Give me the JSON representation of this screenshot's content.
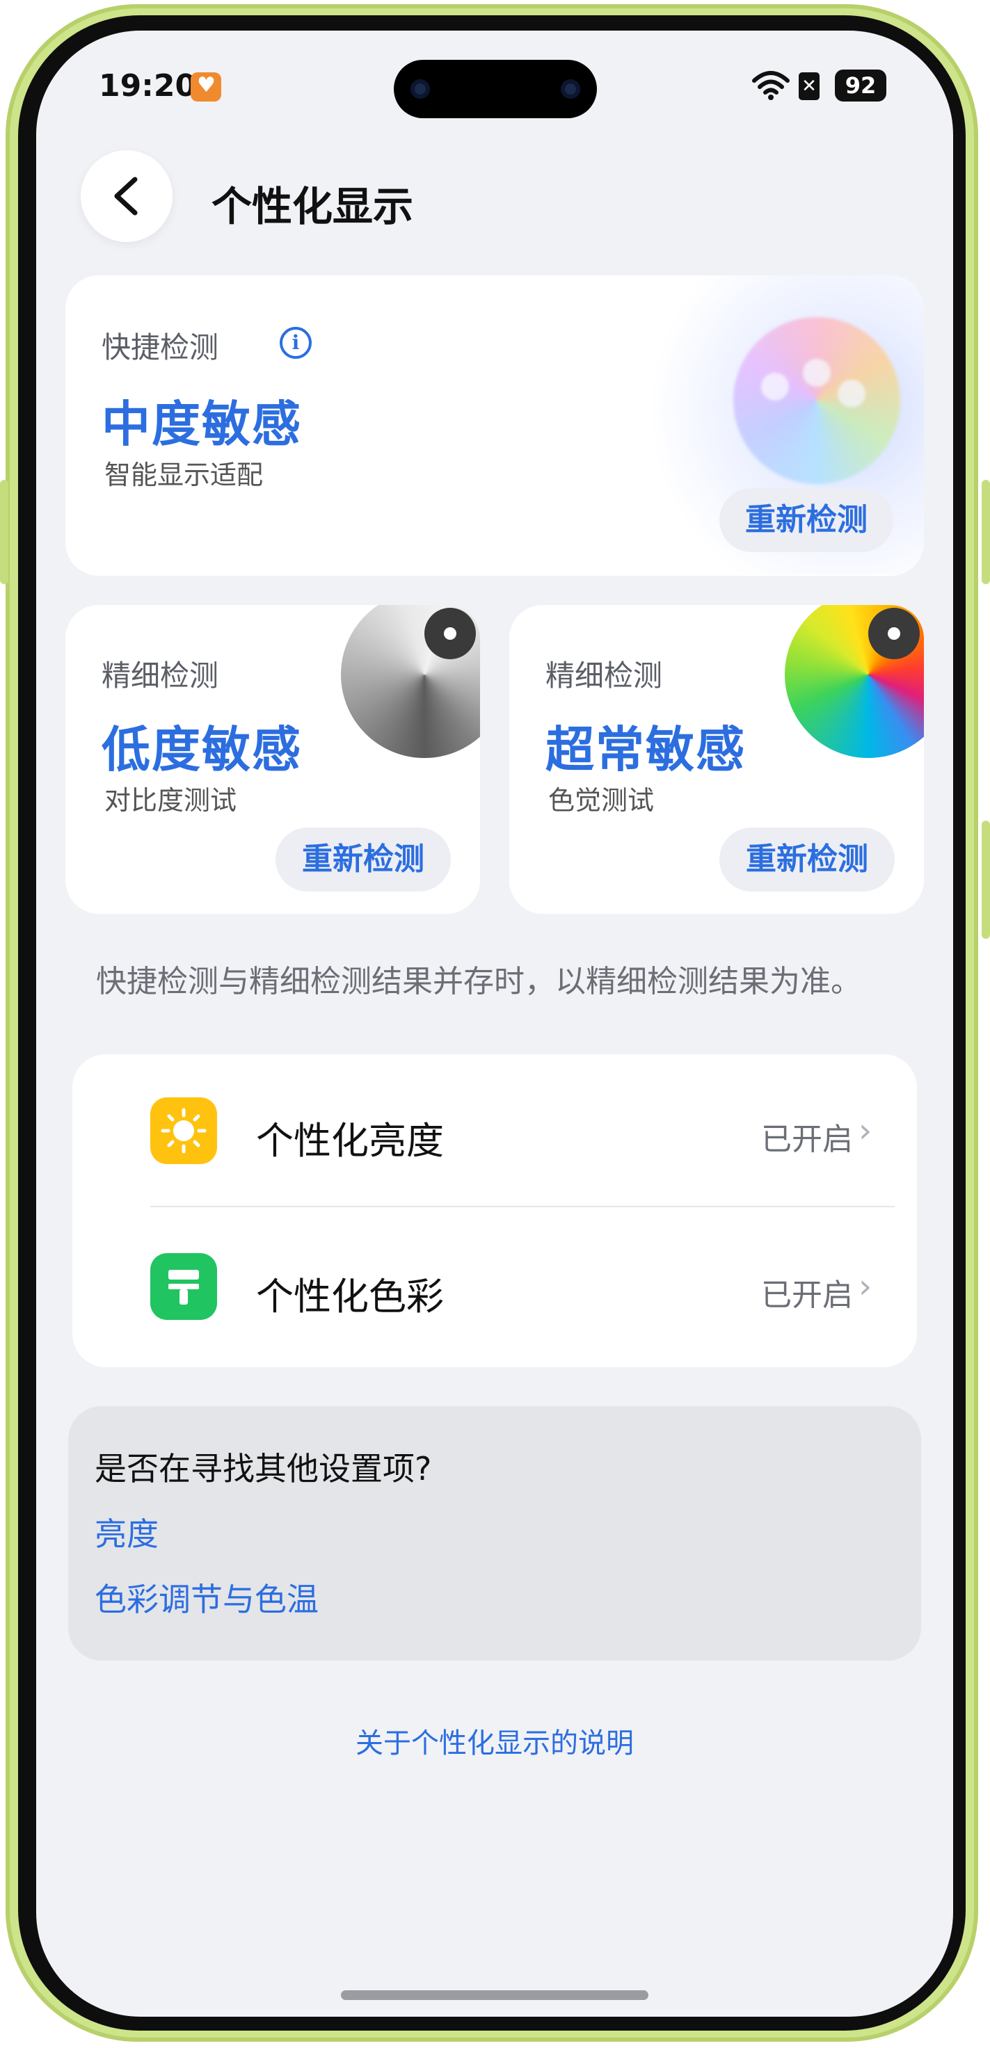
{
  "status_bar": {
    "time": "19:20",
    "wifi_badge": "7",
    "sim_label": "✕",
    "battery": "92"
  },
  "header": {
    "title": "个性化显示"
  },
  "quick_card": {
    "label": "快捷检测",
    "value": "中度敏感",
    "subtitle": "智能显示适配",
    "button": "重新检测"
  },
  "fine_cards": [
    {
      "label": "精细检测",
      "value": "低度敏感",
      "subtitle": "对比度测试",
      "button": "重新检测"
    },
    {
      "label": "精细检测",
      "value": "超常敏感",
      "subtitle": "色觉测试",
      "button": "重新检测"
    }
  ],
  "note": "快捷检测与精细检测结果并存时，以精细检测结果为准。",
  "settings": [
    {
      "label": "个性化亮度",
      "status": "已开启",
      "icon": "sun-icon",
      "color": "#ffc20e"
    },
    {
      "label": "个性化色彩",
      "status": "已开启",
      "icon": "paint-roller-icon",
      "color": "#20c460"
    }
  ],
  "related": {
    "title": "是否在寻找其他设置项?",
    "links": [
      "亮度",
      "色彩调节与色温"
    ]
  },
  "about_link": "关于个性化显示的说明",
  "colors": {
    "accent": "#2c6ee0",
    "background": "#f1f2f6",
    "frame": "#cde48a"
  }
}
